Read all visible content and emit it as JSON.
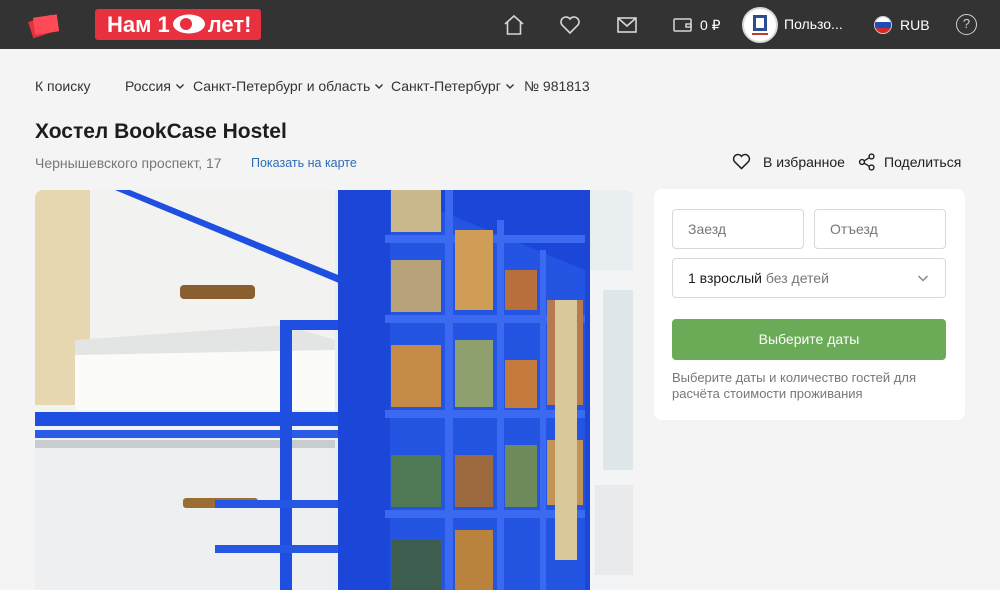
{
  "header": {
    "promo_prefix": "Нам 1",
    "promo_suffix": "лет!",
    "balance": "0 ₽",
    "username": "Пользо...",
    "currency": "RUB",
    "help": "?"
  },
  "breadcrumbs": {
    "back": "К поиску",
    "country": "Россия",
    "region": "Санкт-Петербург и область",
    "city": "Санкт-Петербург",
    "id": "№ 981813"
  },
  "hotel": {
    "title": "Хостел BookCase Hostel",
    "address": "Чернышевского проспект, 17",
    "map_link": "Показать на карте",
    "favorite_label": "В избранное",
    "share_label": "Поделиться"
  },
  "booking": {
    "checkin_placeholder": "Заезд",
    "checkout_placeholder": "Отъезд",
    "guests_main": "1 взрослый",
    "guests_sub": " без детей",
    "button_label": "Выберите даты",
    "hint": "Выберите даты и количество гостей для расчёта стоимости проживания"
  },
  "colors": {
    "header_bg": "#333333",
    "promo": "#e8303f",
    "button": "#6bab58",
    "link": "#2d6bb5"
  }
}
